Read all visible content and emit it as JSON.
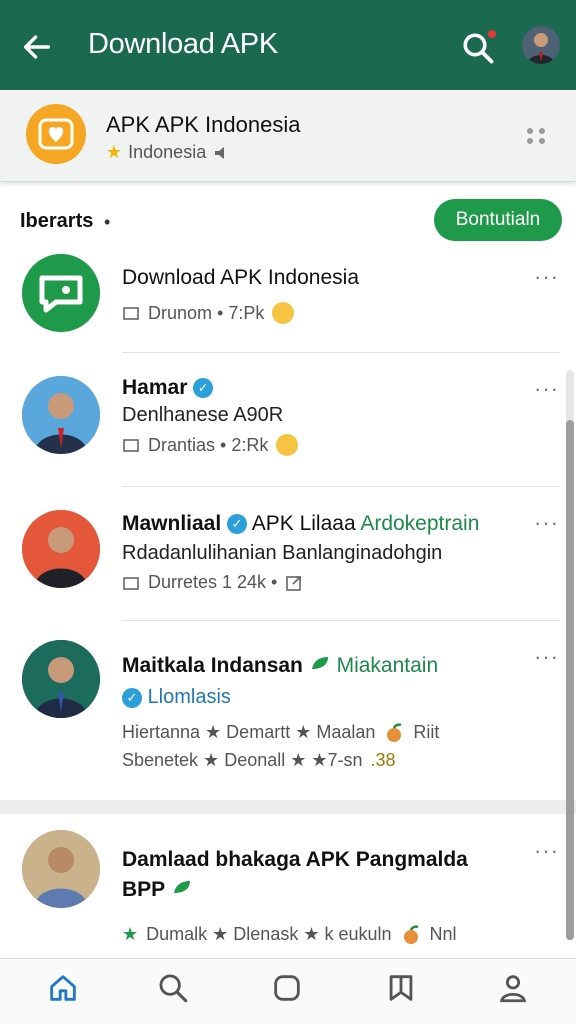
{
  "appbar": {
    "title": "Download APK"
  },
  "app_card": {
    "title": "APK APK Indonesia",
    "subtitle": "Indonesia"
  },
  "section": {
    "title": "Iberarts",
    "dot": "•",
    "follow_label": "Bontutialn"
  },
  "items": [
    {
      "name": "Download APK Indonesia",
      "line2": "",
      "meta": "Drunom  •  7:Pk"
    },
    {
      "name": "Hamar",
      "line2": "Denlhanese A90R",
      "meta": "Drantias  •  2:Rk"
    },
    {
      "name": "Mawnliaal",
      "name_extra": "APK Lilaaa",
      "name_green": "Ardokeptrain",
      "line2": "Rdadanlulihanian Banlanginadohgin",
      "meta": "Durretes  1  24k  •"
    },
    {
      "name": "Maitkala Indansan",
      "name_green": "Miakantain",
      "line2": "Llomlasis",
      "meta1": "Hiertanna  ★  Demartt  ★  Maalan",
      "meta1b": "Riit",
      "meta2": "Sbenetek  ★  Deonall  ★ ★7-sn",
      "meta2b": ".38"
    },
    {
      "name": "Damlaad bhakaga APK Pangmalda",
      "line2": "BPP",
      "meta": "Dumalk  ★  Dlenask  ★  k eukuln",
      "meta_b": "Nnl"
    }
  ],
  "colors": {
    "appbar": "#1b6a4f",
    "accent_green": "#1f9a4b",
    "badge_blue": "#2b9fd9",
    "star_yellow": "#f2b705"
  },
  "icons": {
    "back": "arrow-left-icon",
    "search": "search-icon",
    "profile": "avatar",
    "nav": [
      "home-icon",
      "search-icon",
      "square-icon",
      "bookmark-icon",
      "person-icon"
    ]
  }
}
